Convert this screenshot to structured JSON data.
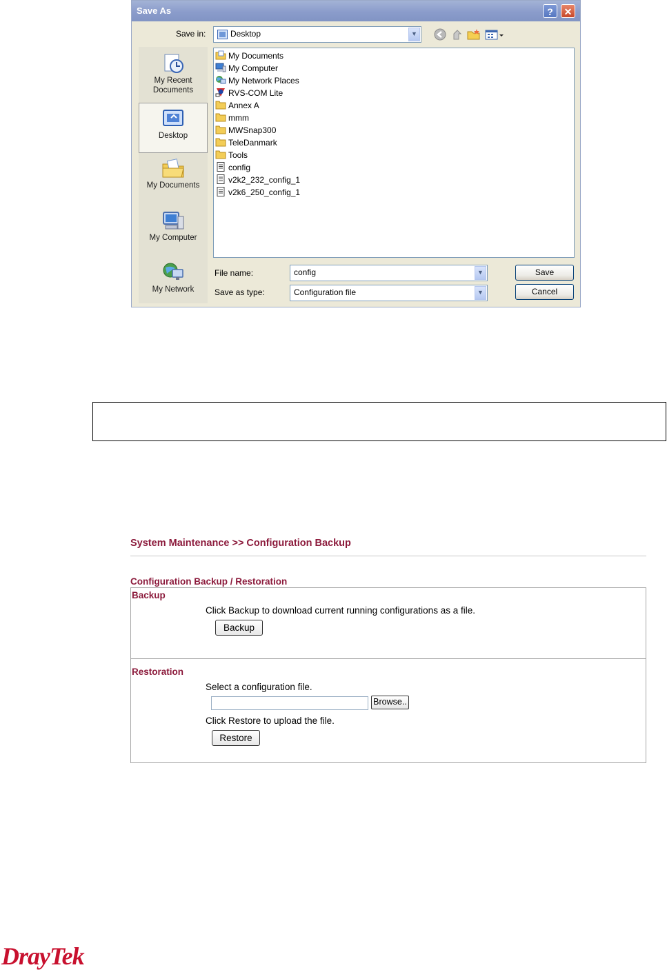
{
  "dialog": {
    "title": "Save As",
    "help_btn": "?",
    "close_btn": "✕",
    "save_in_label": "Save in:",
    "save_in_value": "Desktop",
    "places": [
      {
        "label_line1": "My Recent",
        "label_line2": "Documents",
        "icon": "recent-docs-icon"
      },
      {
        "label_line1": "Desktop",
        "label_line2": "",
        "icon": "desktop-icon"
      },
      {
        "label_line1": "My Documents",
        "label_line2": "",
        "icon": "my-documents-icon"
      },
      {
        "label_line1": "My Computer",
        "label_line2": "",
        "icon": "my-computer-icon"
      },
      {
        "label_line1": "My Network",
        "label_line2": "",
        "icon": "my-network-icon"
      }
    ],
    "files": [
      {
        "name": "My Documents",
        "icon": "my-documents-icon"
      },
      {
        "name": "My Computer",
        "icon": "my-computer-icon"
      },
      {
        "name": "My Network Places",
        "icon": "network-places-icon"
      },
      {
        "name": "RVS-COM Lite",
        "icon": "app-shortcut-icon"
      },
      {
        "name": "Annex A",
        "icon": "folder-icon"
      },
      {
        "name": "mmm",
        "icon": "folder-icon"
      },
      {
        "name": "MWSnap300",
        "icon": "folder-icon"
      },
      {
        "name": "TeleDanmark",
        "icon": "folder-icon"
      },
      {
        "name": "Tools",
        "icon": "folder-icon"
      },
      {
        "name": "config",
        "icon": "text-file-icon"
      },
      {
        "name": "v2k2_232_config_1",
        "icon": "text-file-icon"
      },
      {
        "name": "v2k6_250_config_1",
        "icon": "text-file-icon"
      }
    ],
    "file_name_label": "File name:",
    "file_name_value": "config",
    "save_type_label": "Save as type:",
    "save_type_value": "Configuration file",
    "save_btn": "Save",
    "cancel_btn": "Cancel"
  },
  "web": {
    "breadcrumb": "System Maintenance >> Configuration Backup",
    "section_title": "Configuration Backup / Restoration",
    "backup_heading": "Backup",
    "backup_text": "Click Backup to download current running configurations as a file.",
    "backup_btn": "Backup",
    "restore_heading": "Restoration",
    "select_text": "Select a configuration file.",
    "browse_btn": "Browse..",
    "restore_text": "Click Restore to upload the file.",
    "restore_btn": "Restore"
  },
  "logo": {
    "text": "DrayTek"
  },
  "colors": {
    "accent": "#8c1b3c",
    "logo": "#c8102e"
  }
}
